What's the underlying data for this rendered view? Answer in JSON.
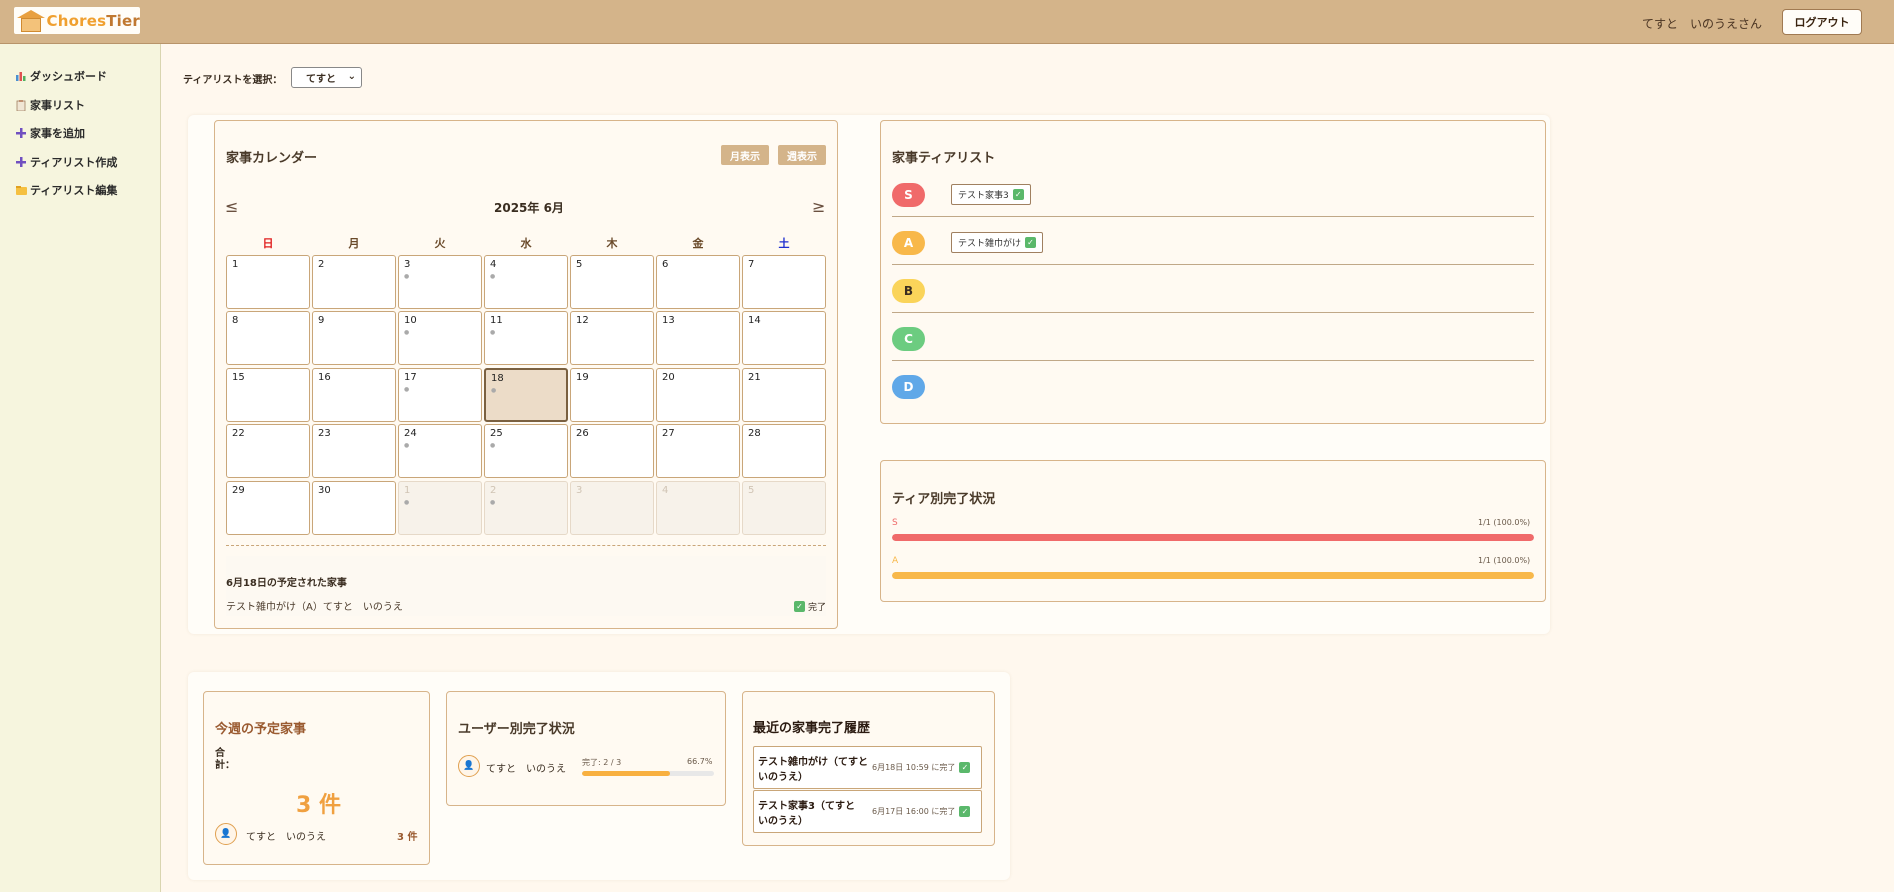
{
  "header": {
    "logo_part1": "Chores",
    "logo_part2": "Tier",
    "user_name": "てすと　いのうえさん",
    "logout_label": "ログアウト"
  },
  "sidebar": {
    "items": [
      {
        "label": "ダッシュボード",
        "icon": "chart-icon"
      },
      {
        "label": "家事リスト",
        "icon": "clipboard-icon"
      },
      {
        "label": "家事を追加",
        "icon": "plus-icon"
      },
      {
        "label": "ティアリスト作成",
        "icon": "plus-icon"
      },
      {
        "label": "ティアリスト編集",
        "icon": "folder-icon"
      }
    ]
  },
  "tier_select": {
    "label": "ティアリストを選択：",
    "value": "てすと"
  },
  "calendar": {
    "title": "家事カレンダー",
    "month_view_label": "月表示",
    "week_view_label": "週表示",
    "prev": "≤",
    "next": "≥",
    "month_label": "2025年 6月",
    "weekdays": [
      "日",
      "月",
      "火",
      "水",
      "木",
      "金",
      "土"
    ],
    "weekday_colors": [
      "#e02020",
      "#6a4a2a",
      "#6a4a2a",
      "#6a4a2a",
      "#6a4a2a",
      "#6a4a2a",
      "#2030d0"
    ],
    "days": [
      {
        "n": "1"
      },
      {
        "n": "2"
      },
      {
        "n": "3",
        "dot": true
      },
      {
        "n": "4",
        "dot": true
      },
      {
        "n": "5"
      },
      {
        "n": "6"
      },
      {
        "n": "7"
      },
      {
        "n": "8"
      },
      {
        "n": "9"
      },
      {
        "n": "10",
        "dot": true
      },
      {
        "n": "11",
        "dot": true
      },
      {
        "n": "12"
      },
      {
        "n": "13"
      },
      {
        "n": "14"
      },
      {
        "n": "15"
      },
      {
        "n": "16"
      },
      {
        "n": "17",
        "dot": true
      },
      {
        "n": "18",
        "dot": true,
        "today": true
      },
      {
        "n": "19"
      },
      {
        "n": "20"
      },
      {
        "n": "21"
      },
      {
        "n": "22"
      },
      {
        "n": "23"
      },
      {
        "n": "24",
        "dot": true
      },
      {
        "n": "25",
        "dot": true
      },
      {
        "n": "26"
      },
      {
        "n": "27"
      },
      {
        "n": "28"
      },
      {
        "n": "29"
      },
      {
        "n": "30"
      },
      {
        "n": "1",
        "dot": true,
        "other": true
      },
      {
        "n": "2",
        "dot": true,
        "other": true
      },
      {
        "n": "3",
        "other": true
      },
      {
        "n": "4",
        "other": true
      },
      {
        "n": "5",
        "other": true
      }
    ],
    "schedule_title": "6月18日の予定された家事",
    "schedule_item": "テスト雑巾がけ（A）てすと　いのうえ",
    "schedule_status": "完了"
  },
  "tier_list": {
    "title": "家事ティアリスト",
    "tiers": [
      {
        "name": "S",
        "color": "#f06a6a"
      },
      {
        "name": "A",
        "color": "#f8b84a"
      },
      {
        "name": "B",
        "color": "#fad45a",
        "text_color": "#3a2d20"
      },
      {
        "name": "C",
        "color": "#6ccc80"
      },
      {
        "name": "D",
        "color": "#60a8e8"
      }
    ],
    "s_chore": "テスト家事3",
    "a_chore": "テスト雑巾がけ"
  },
  "tier_progress": {
    "title": "ティア別完了状況",
    "rows": [
      {
        "tier": "S",
        "text": "1/1 (100.0%)",
        "fraction": 1.0,
        "color": "#f06a6a"
      },
      {
        "tier": "A",
        "text": "1/1 (100.0%)",
        "fraction": 1.0,
        "color": "#f8b84a"
      }
    ]
  },
  "weekly": {
    "title": "今週の予定家事",
    "total_label": "合計：",
    "count": "3 件",
    "user": "てすと　いのうえ",
    "user_count": "3 件"
  },
  "user_progress": {
    "title": "ユーザー別完了状況",
    "user": "てすと　いのうえ",
    "done_text": "完了: 2 / 3",
    "percent_text": "66.7%",
    "fraction": 0.667
  },
  "history": {
    "title": "最近の家事完了履歴",
    "items": [
      {
        "line1": "テスト雑巾がけ（てすと",
        "line2": "いのうえ）",
        "time": "6月18日 10:59 に完了"
      },
      {
        "line1": "テスト家事3（てすと",
        "line2": "いのうえ）",
        "time": "6月17日 16:00 に完了"
      }
    ]
  }
}
